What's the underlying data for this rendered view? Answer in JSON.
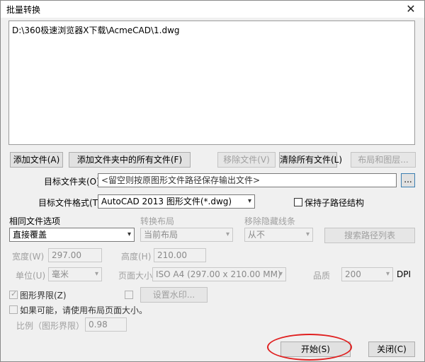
{
  "window": {
    "title": "批量转换",
    "close_glyph": "✕"
  },
  "files": [
    "D:\\360极速浏览器X下载\\AcmeCAD\\1.dwg"
  ],
  "file_buttons": {
    "add_file": "添加文件(A)",
    "add_folder": "添加文件夹中的所有文件(F)",
    "remove_file": "移除文件(V)",
    "remove_all": "清除所有文件(L)",
    "layout": "布局和图层..."
  },
  "target_folder": {
    "label": "目标文件夹(O)",
    "placeholder": "<留空则按原图形文件路径保存输出文件>",
    "browse": "..."
  },
  "target_format": {
    "label": "目标文件格式(T)",
    "value": "AutoCAD 2013 图形文件(*.dwg)",
    "keep_subpath": "保持子路径结构"
  },
  "same_file": {
    "label": "相同文件选项",
    "value": "直接覆盖"
  },
  "convert_layout": {
    "label": "转换布局",
    "value": "当前布局"
  },
  "hidden_lines": {
    "label": "移除隐藏线条",
    "value": "从不"
  },
  "search_path_btn": "搜索路径列表",
  "width": {
    "label": "宽度(W)",
    "value": "297.00"
  },
  "height": {
    "label": "高度(H)",
    "value": "210.00"
  },
  "unit": {
    "label": "单位(U)",
    "value": "毫米"
  },
  "page_size": {
    "label": "页面大小",
    "value": "ISO A4 (297.00 x 210.00 MM)"
  },
  "quality": {
    "label": "品质",
    "value": "200",
    "unit": "DPI"
  },
  "extents": {
    "label": "图形界限(Z)",
    "checked": true
  },
  "watermark_btn": "设置水印...",
  "use_layout": {
    "label": "如果可能，请使用布局页面大小。"
  },
  "ratio": {
    "label": "比例（图形界限）",
    "value": "0.98"
  },
  "start_btn": "开始(S)",
  "close_btn": "关闭(C)"
}
